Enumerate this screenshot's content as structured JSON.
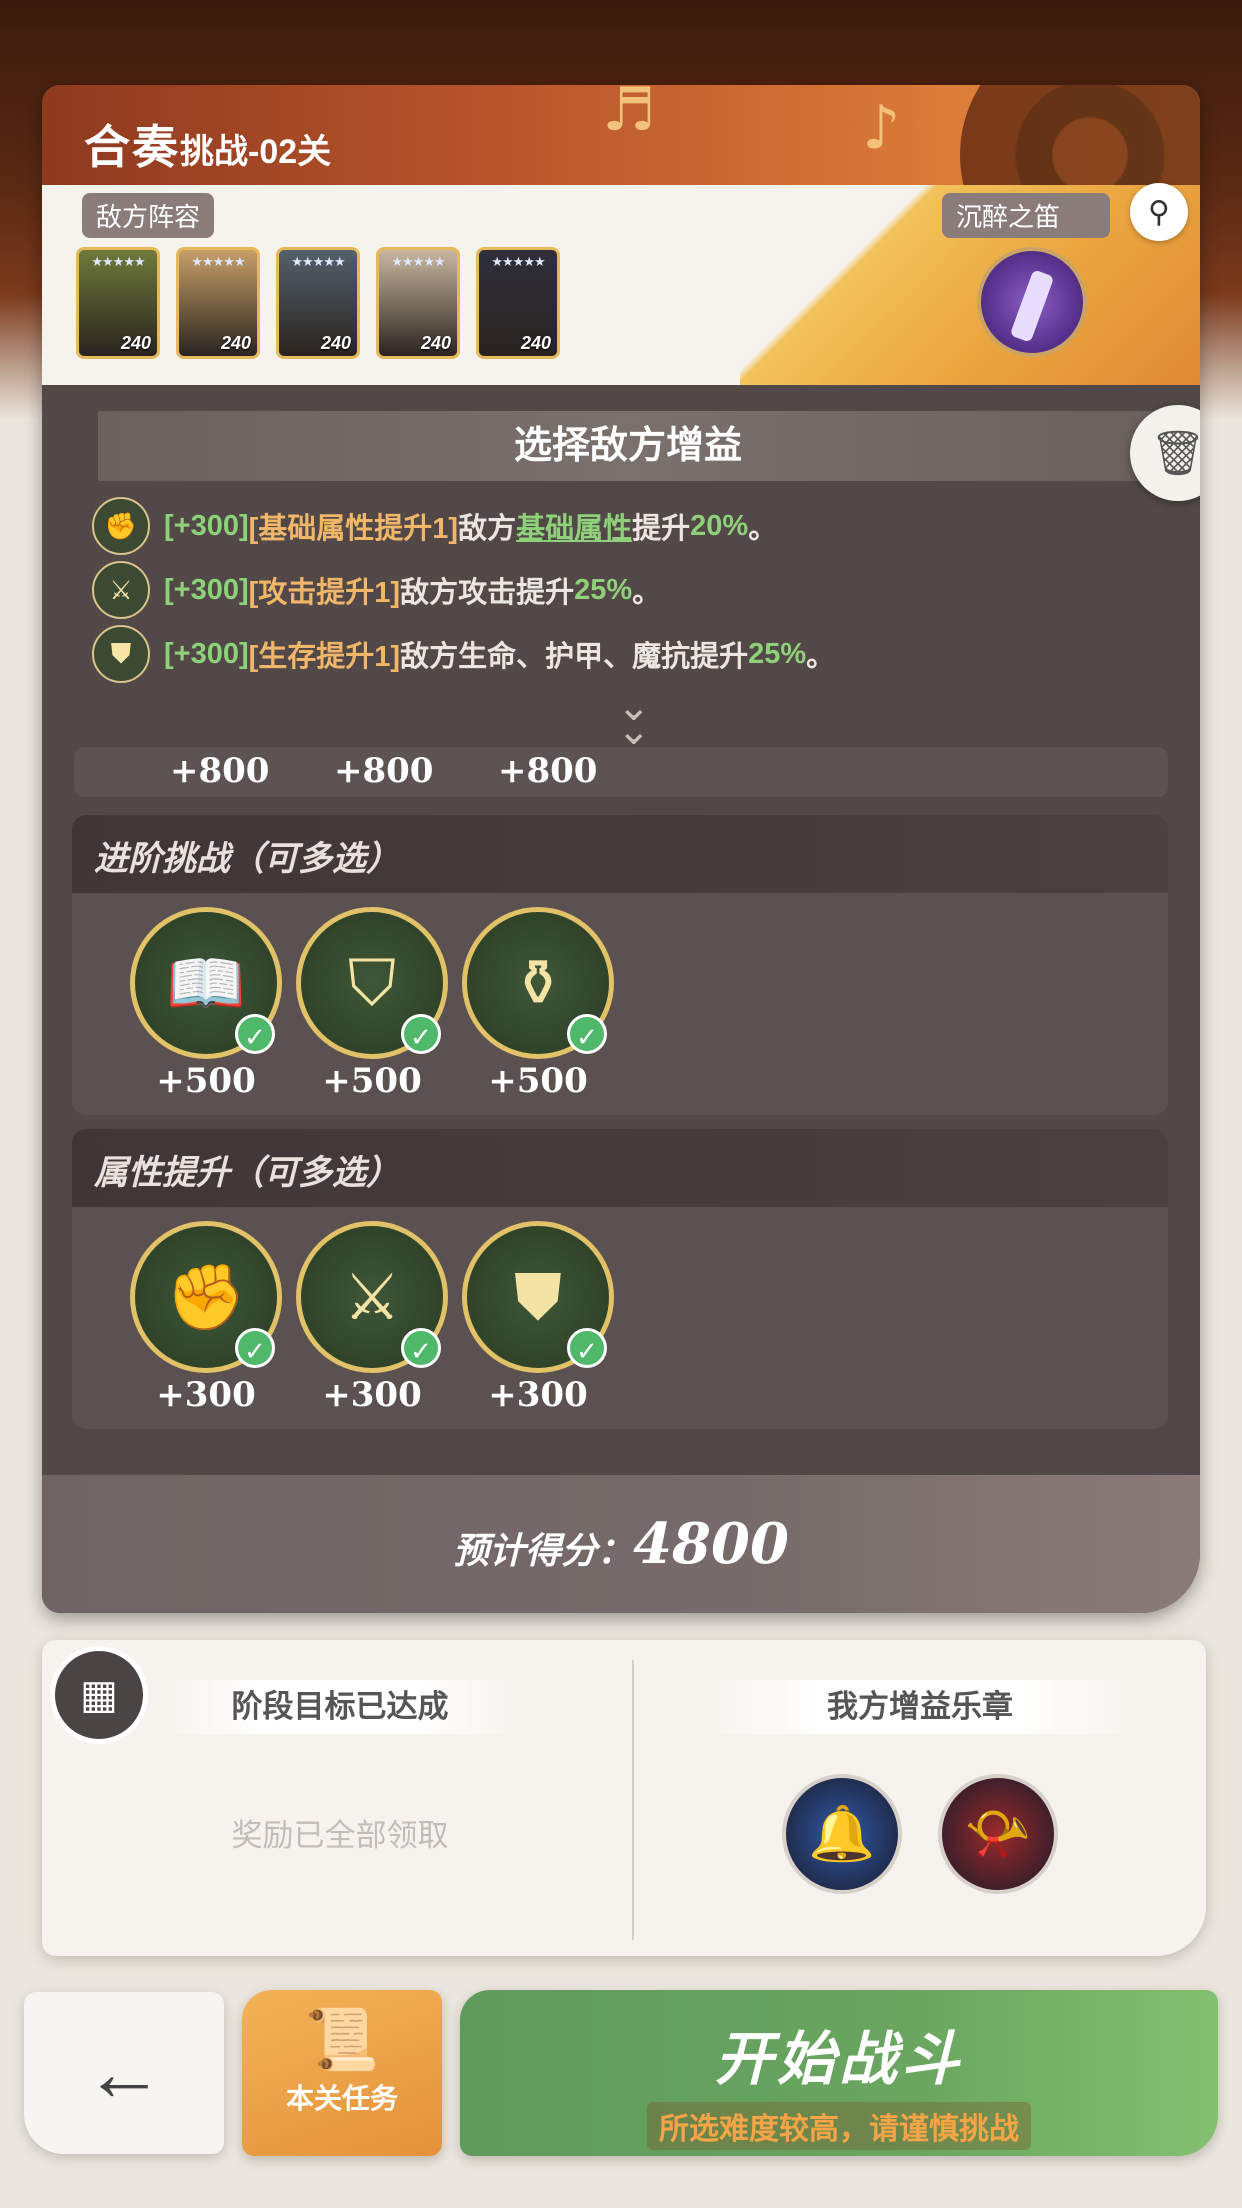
{
  "header": {
    "title_main": "合奏",
    "title_sub": "挑战-02关"
  },
  "enemy": {
    "tag": "敌方阵容",
    "artifact_tag": "沉醉之笛",
    "heroes": [
      {
        "level": "240",
        "stars": "★★★★★",
        "color": "#6e7a3a"
      },
      {
        "level": "240",
        "stars": "★★★★★",
        "color": "#c7a068"
      },
      {
        "level": "240",
        "stars": "★★★★★",
        "color": "#54606a"
      },
      {
        "level": "240",
        "stars": "★★★★★",
        "color": "#c9b7a0"
      },
      {
        "level": "240",
        "stars": "★★★★★",
        "color": "#2f2f3a"
      }
    ]
  },
  "buff_section": {
    "title": "选择敌方增益",
    "buffs": [
      {
        "points": "[+300]",
        "name": "[基础属性提升1]",
        "text1": "敌方",
        "highlight": "基础属性",
        "text2": "提升",
        "value": "20%",
        "end": "。"
      },
      {
        "points": "[+300]",
        "name": "[攻击提升1]",
        "text1": "敌方攻击提升",
        "highlight": "",
        "text2": "",
        "value": "25%",
        "end": "。"
      },
      {
        "points": "[+300]",
        "name": "[生存提升1]",
        "text1": "敌方生命、护甲、魔抗提升",
        "highlight": "",
        "text2": "",
        "value": "25%",
        "end": "。"
      }
    ],
    "hidden_row_scores": [
      "+800",
      "+800",
      "+800"
    ]
  },
  "groups": [
    {
      "title": "进阶挑战（可多选）",
      "options": [
        {
          "icon": "book-icon",
          "glyph": "📖",
          "value": "+500",
          "selected": true
        },
        {
          "icon": "shield-up-icon",
          "glyph": "⛉",
          "value": "+500",
          "selected": true
        },
        {
          "icon": "potion-icon",
          "glyph": "⚱",
          "value": "+500",
          "selected": true
        }
      ]
    },
    {
      "title": "属性提升（可多选）",
      "options": [
        {
          "icon": "muscle-icon",
          "glyph": "✊",
          "value": "+300",
          "selected": true
        },
        {
          "icon": "sword-icon",
          "glyph": "⚔",
          "value": "+300",
          "selected": true
        },
        {
          "icon": "shield-icon",
          "glyph": "⛊",
          "value": "+300",
          "selected": true
        }
      ]
    }
  ],
  "estimate": {
    "label": "预计得分：",
    "value": "4800"
  },
  "stage_goal": {
    "title": "阶段目标已达成",
    "status": "奖励已全部领取"
  },
  "our_buffs": {
    "title": "我方增益乐章",
    "songs": [
      {
        "icon": "bell-icon",
        "glyph": "🔔",
        "color": "#2f5aa8"
      },
      {
        "icon": "horn-icon",
        "glyph": "📯",
        "color": "#9a2a2a"
      }
    ]
  },
  "actions": {
    "back_icon": "←",
    "task_label": "本关任务",
    "start_label": "开始战斗",
    "start_warning": "所选难度较高，请谨慎挑战"
  },
  "colors": {
    "accent_green": "#8fd17a",
    "accent_orange": "#f0b66a",
    "start_green": "#6aa660"
  }
}
